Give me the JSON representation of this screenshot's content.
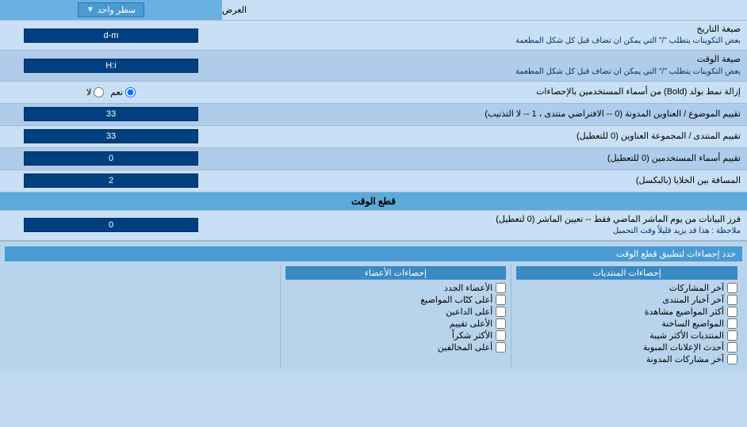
{
  "header": {
    "dropdown_label": "سطر واحد",
    "right_label": "العرض"
  },
  "rows": [
    {
      "id": "date_format",
      "label": "صيغة التاريخ",
      "sublabel": "بعض التكوينات يتطلب \"/\" التي يمكن ان تضاف قبل كل شكل المطعمة",
      "input_value": "d-m",
      "input_type": "text"
    },
    {
      "id": "time_format",
      "label": "صيغة الوقت",
      "sublabel": "بعض التكوينات يتطلب \"/\" التي يمكن ان تضاف قبل كل شكل المطعمة",
      "input_value": "H:i",
      "input_type": "text"
    },
    {
      "id": "bold_remove",
      "label": "إزالة نمط بولد (Bold) من أسماء المستخدمين بالإحصاءات",
      "input_type": "radio",
      "radio_options": [
        {
          "value": "yes",
          "label": "نعم",
          "checked": true
        },
        {
          "value": "no",
          "label": "لا",
          "checked": false
        }
      ]
    },
    {
      "id": "topic_order",
      "label": "تقييم الموضوع / العناوين المدونة (0 -- الافتراضي منتدى ، 1 -- لا التذنيب)",
      "input_value": "33",
      "input_type": "text"
    },
    {
      "id": "forum_order",
      "label": "تقييم المنتدى / المجموعة العناوين (0 للتعطيل)",
      "input_value": "33",
      "input_type": "text"
    },
    {
      "id": "users_order",
      "label": "تقييم أسماء المستخدمين (0 للتعطيل)",
      "input_value": "0",
      "input_type": "text"
    },
    {
      "id": "cell_gap",
      "label": "المسافة بين الخلايا (بالبكسل)",
      "input_value": "2",
      "input_type": "text"
    }
  ],
  "time_section": {
    "header": "قطع الوقت",
    "row_label": "فرز البيانات من يوم الماشر الماضي فقط -- تعيين الماشر (0 لتعطيل)",
    "row_sublabel": "ملاحظة : هذا قد يزيد قليلاً وقت التحميل",
    "input_value": "0"
  },
  "stats_section": {
    "header_label": "حدد إحصاءات لتطبيق قطع الوقت",
    "col1": {
      "header": "إحصاءات المنتديات",
      "items": [
        "آخر المشاركات",
        "آخر أخبار المنتدى",
        "أكثر المواضيع مشاهدة",
        "المواضيع الساخنة",
        "المنتديات الأكثر شيبة",
        "أحدث الإعلانات المبوبة",
        "آخر مشاركات المدونة"
      ]
    },
    "col2": {
      "header": "إحصاءات الأعضاء",
      "items": [
        "الأعضاء الجدد",
        "أعلى كتّاب المواضيع",
        "أعلى الداعين",
        "الأعلى تقييم",
        "الأكثر شكراً",
        "أعلى المخالفين"
      ]
    }
  }
}
